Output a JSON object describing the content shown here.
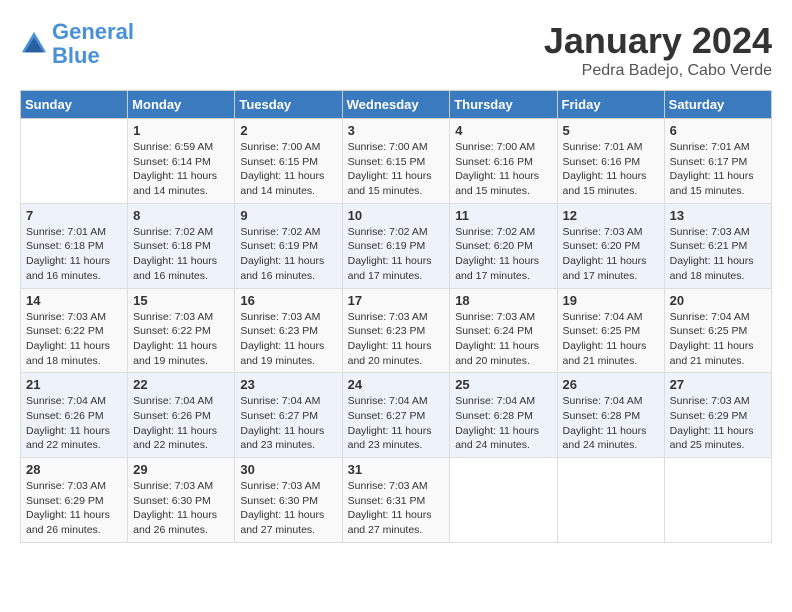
{
  "header": {
    "logo_line1": "General",
    "logo_line2": "Blue",
    "month": "January 2024",
    "location": "Pedra Badejo, Cabo Verde"
  },
  "weekdays": [
    "Sunday",
    "Monday",
    "Tuesday",
    "Wednesday",
    "Thursday",
    "Friday",
    "Saturday"
  ],
  "weeks": [
    [
      {
        "day": "",
        "sunrise": "",
        "sunset": "",
        "daylight": ""
      },
      {
        "day": "1",
        "sunrise": "Sunrise: 6:59 AM",
        "sunset": "Sunset: 6:14 PM",
        "daylight": "Daylight: 11 hours and 14 minutes."
      },
      {
        "day": "2",
        "sunrise": "Sunrise: 7:00 AM",
        "sunset": "Sunset: 6:15 PM",
        "daylight": "Daylight: 11 hours and 14 minutes."
      },
      {
        "day": "3",
        "sunrise": "Sunrise: 7:00 AM",
        "sunset": "Sunset: 6:15 PM",
        "daylight": "Daylight: 11 hours and 15 minutes."
      },
      {
        "day": "4",
        "sunrise": "Sunrise: 7:00 AM",
        "sunset": "Sunset: 6:16 PM",
        "daylight": "Daylight: 11 hours and 15 minutes."
      },
      {
        "day": "5",
        "sunrise": "Sunrise: 7:01 AM",
        "sunset": "Sunset: 6:16 PM",
        "daylight": "Daylight: 11 hours and 15 minutes."
      },
      {
        "day": "6",
        "sunrise": "Sunrise: 7:01 AM",
        "sunset": "Sunset: 6:17 PM",
        "daylight": "Daylight: 11 hours and 15 minutes."
      }
    ],
    [
      {
        "day": "7",
        "sunrise": "Sunrise: 7:01 AM",
        "sunset": "Sunset: 6:18 PM",
        "daylight": "Daylight: 11 hours and 16 minutes."
      },
      {
        "day": "8",
        "sunrise": "Sunrise: 7:02 AM",
        "sunset": "Sunset: 6:18 PM",
        "daylight": "Daylight: 11 hours and 16 minutes."
      },
      {
        "day": "9",
        "sunrise": "Sunrise: 7:02 AM",
        "sunset": "Sunset: 6:19 PM",
        "daylight": "Daylight: 11 hours and 16 minutes."
      },
      {
        "day": "10",
        "sunrise": "Sunrise: 7:02 AM",
        "sunset": "Sunset: 6:19 PM",
        "daylight": "Daylight: 11 hours and 17 minutes."
      },
      {
        "day": "11",
        "sunrise": "Sunrise: 7:02 AM",
        "sunset": "Sunset: 6:20 PM",
        "daylight": "Daylight: 11 hours and 17 minutes."
      },
      {
        "day": "12",
        "sunrise": "Sunrise: 7:03 AM",
        "sunset": "Sunset: 6:20 PM",
        "daylight": "Daylight: 11 hours and 17 minutes."
      },
      {
        "day": "13",
        "sunrise": "Sunrise: 7:03 AM",
        "sunset": "Sunset: 6:21 PM",
        "daylight": "Daylight: 11 hours and 18 minutes."
      }
    ],
    [
      {
        "day": "14",
        "sunrise": "Sunrise: 7:03 AM",
        "sunset": "Sunset: 6:22 PM",
        "daylight": "Daylight: 11 hours and 18 minutes."
      },
      {
        "day": "15",
        "sunrise": "Sunrise: 7:03 AM",
        "sunset": "Sunset: 6:22 PM",
        "daylight": "Daylight: 11 hours and 19 minutes."
      },
      {
        "day": "16",
        "sunrise": "Sunrise: 7:03 AM",
        "sunset": "Sunset: 6:23 PM",
        "daylight": "Daylight: 11 hours and 19 minutes."
      },
      {
        "day": "17",
        "sunrise": "Sunrise: 7:03 AM",
        "sunset": "Sunset: 6:23 PM",
        "daylight": "Daylight: 11 hours and 20 minutes."
      },
      {
        "day": "18",
        "sunrise": "Sunrise: 7:03 AM",
        "sunset": "Sunset: 6:24 PM",
        "daylight": "Daylight: 11 hours and 20 minutes."
      },
      {
        "day": "19",
        "sunrise": "Sunrise: 7:04 AM",
        "sunset": "Sunset: 6:25 PM",
        "daylight": "Daylight: 11 hours and 21 minutes."
      },
      {
        "day": "20",
        "sunrise": "Sunrise: 7:04 AM",
        "sunset": "Sunset: 6:25 PM",
        "daylight": "Daylight: 11 hours and 21 minutes."
      }
    ],
    [
      {
        "day": "21",
        "sunrise": "Sunrise: 7:04 AM",
        "sunset": "Sunset: 6:26 PM",
        "daylight": "Daylight: 11 hours and 22 minutes."
      },
      {
        "day": "22",
        "sunrise": "Sunrise: 7:04 AM",
        "sunset": "Sunset: 6:26 PM",
        "daylight": "Daylight: 11 hours and 22 minutes."
      },
      {
        "day": "23",
        "sunrise": "Sunrise: 7:04 AM",
        "sunset": "Sunset: 6:27 PM",
        "daylight": "Daylight: 11 hours and 23 minutes."
      },
      {
        "day": "24",
        "sunrise": "Sunrise: 7:04 AM",
        "sunset": "Sunset: 6:27 PM",
        "daylight": "Daylight: 11 hours and 23 minutes."
      },
      {
        "day": "25",
        "sunrise": "Sunrise: 7:04 AM",
        "sunset": "Sunset: 6:28 PM",
        "daylight": "Daylight: 11 hours and 24 minutes."
      },
      {
        "day": "26",
        "sunrise": "Sunrise: 7:04 AM",
        "sunset": "Sunset: 6:28 PM",
        "daylight": "Daylight: 11 hours and 24 minutes."
      },
      {
        "day": "27",
        "sunrise": "Sunrise: 7:03 AM",
        "sunset": "Sunset: 6:29 PM",
        "daylight": "Daylight: 11 hours and 25 minutes."
      }
    ],
    [
      {
        "day": "28",
        "sunrise": "Sunrise: 7:03 AM",
        "sunset": "Sunset: 6:29 PM",
        "daylight": "Daylight: 11 hours and 26 minutes."
      },
      {
        "day": "29",
        "sunrise": "Sunrise: 7:03 AM",
        "sunset": "Sunset: 6:30 PM",
        "daylight": "Daylight: 11 hours and 26 minutes."
      },
      {
        "day": "30",
        "sunrise": "Sunrise: 7:03 AM",
        "sunset": "Sunset: 6:30 PM",
        "daylight": "Daylight: 11 hours and 27 minutes."
      },
      {
        "day": "31",
        "sunrise": "Sunrise: 7:03 AM",
        "sunset": "Sunset: 6:31 PM",
        "daylight": "Daylight: 11 hours and 27 minutes."
      },
      {
        "day": "",
        "sunrise": "",
        "sunset": "",
        "daylight": ""
      },
      {
        "day": "",
        "sunrise": "",
        "sunset": "",
        "daylight": ""
      },
      {
        "day": "",
        "sunrise": "",
        "sunset": "",
        "daylight": ""
      }
    ]
  ]
}
